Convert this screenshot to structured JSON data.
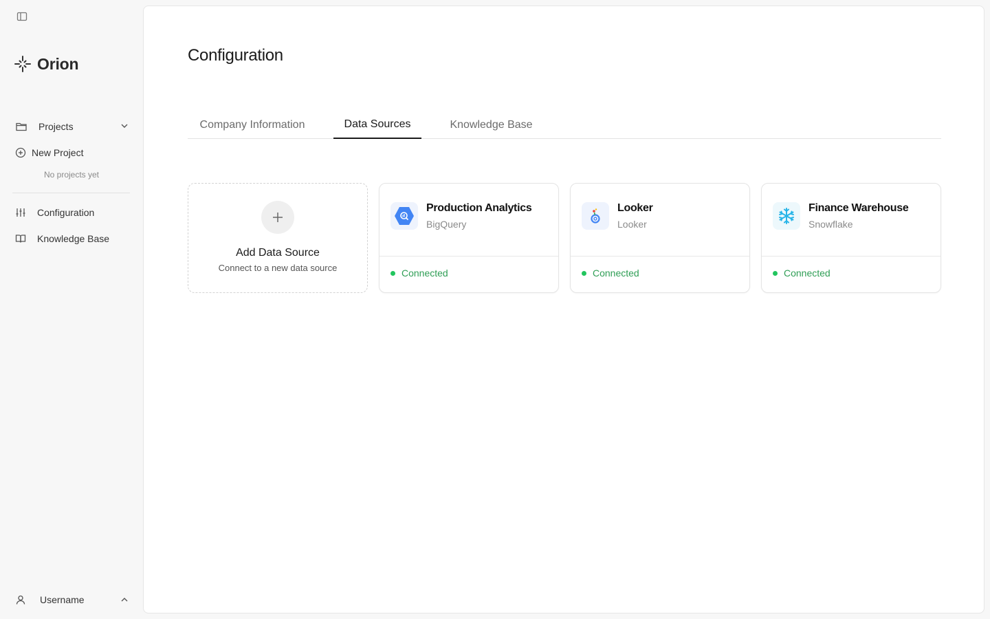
{
  "app": {
    "name": "Orion"
  },
  "sidebar": {
    "projects_label": "Projects",
    "new_project_label": "New Project",
    "empty_note": "No projects yet",
    "items": [
      {
        "label": "Configuration",
        "icon": "sliders-icon"
      },
      {
        "label": "Knowledge Base",
        "icon": "book-icon"
      }
    ],
    "user_label": "Username"
  },
  "main": {
    "title": "Configuration",
    "tabs": [
      {
        "label": "Company Information",
        "active": false
      },
      {
        "label": "Data Sources",
        "active": true
      },
      {
        "label": "Knowledge Base",
        "active": false
      }
    ],
    "add_card": {
      "title": "Add Data Source",
      "subtitle": "Connect to a new data source"
    },
    "sources": [
      {
        "name": "Production Analytics",
        "type": "BigQuery",
        "status": "Connected",
        "icon": "bigquery-icon"
      },
      {
        "name": "Looker",
        "type": "Looker",
        "status": "Connected",
        "icon": "looker-icon"
      },
      {
        "name": "Finance Warehouse",
        "type": "Snowflake",
        "status": "Connected",
        "icon": "snowflake-icon"
      }
    ]
  },
  "colors": {
    "status_green": "#22c55e",
    "bigquery_blue": "#4285f4",
    "snowflake_cyan": "#29b5e8"
  }
}
